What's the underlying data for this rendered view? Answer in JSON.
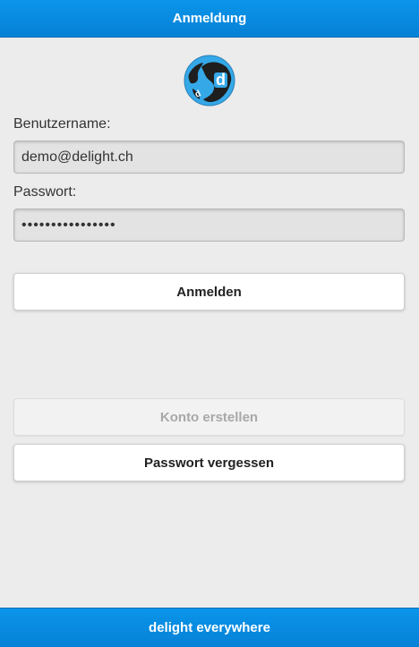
{
  "header": {
    "title": "Anmeldung"
  },
  "logo": {
    "icon": "delight-globe-logo-icon",
    "letter": "d"
  },
  "form": {
    "username_label": "Benutzername:",
    "username_value": "demo@delight.ch",
    "password_label": "Passwort:",
    "password_value": "••••••••••••••••"
  },
  "buttons": {
    "login": "Anmelden",
    "create_account": "Konto erstellen",
    "forgot_password": "Passwort vergessen"
  },
  "footer": {
    "text": "delight everywhere"
  },
  "colors": {
    "accent": "#0789dd",
    "background": "#ececec",
    "logo_blue": "#35a8e8",
    "logo_dark": "#1e1e1e"
  }
}
